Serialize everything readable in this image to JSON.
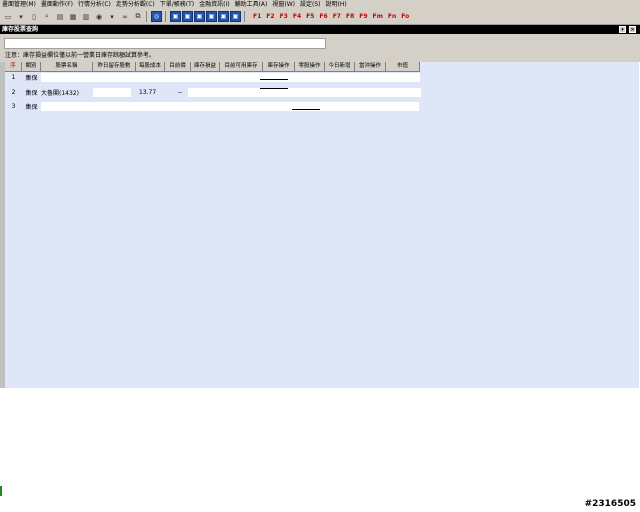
{
  "menu": [
    "畫面管理(M)",
    "畫面動作(F)",
    "行情分析(C)",
    "走勢分析觀(C)",
    "下單/帳務(T)",
    "金融資訊(I)",
    "輔助工具(A)",
    "視窗(W)",
    "設定(S)",
    "說明(H)"
  ],
  "toolbar": {
    "fkeys": [
      "F1",
      "F2",
      "F3",
      "F4",
      "F5",
      "F6",
      "F7",
      "F8",
      "F9",
      "Fm",
      "Fn",
      "Fo"
    ]
  },
  "window": {
    "title": "庫存股票查詢"
  },
  "panel": {
    "note": "注意：庫存損益欄位僅以前一營業日庫存餘額試算參考。"
  },
  "table": {
    "columns": [
      "序",
      "類別",
      "股票名稱",
      "昨日留存股數",
      "每股成本",
      "目前價",
      "庫存損益",
      "目前可用庫存",
      "庫存操作",
      "零股操作",
      "今日新增",
      "當沖操作",
      "市值"
    ],
    "rows": [
      {
        "no": "1",
        "category": "集保",
        "name": "",
        "price": "",
        "change": ""
      },
      {
        "no": "2",
        "category": "集保",
        "name": "大魯閣(1432)",
        "price": "13.77",
        "change": "--"
      },
      {
        "no": "3",
        "category": "集保",
        "name": "",
        "price": "",
        "change": ""
      }
    ]
  },
  "footer": {
    "id": "#2316505"
  }
}
